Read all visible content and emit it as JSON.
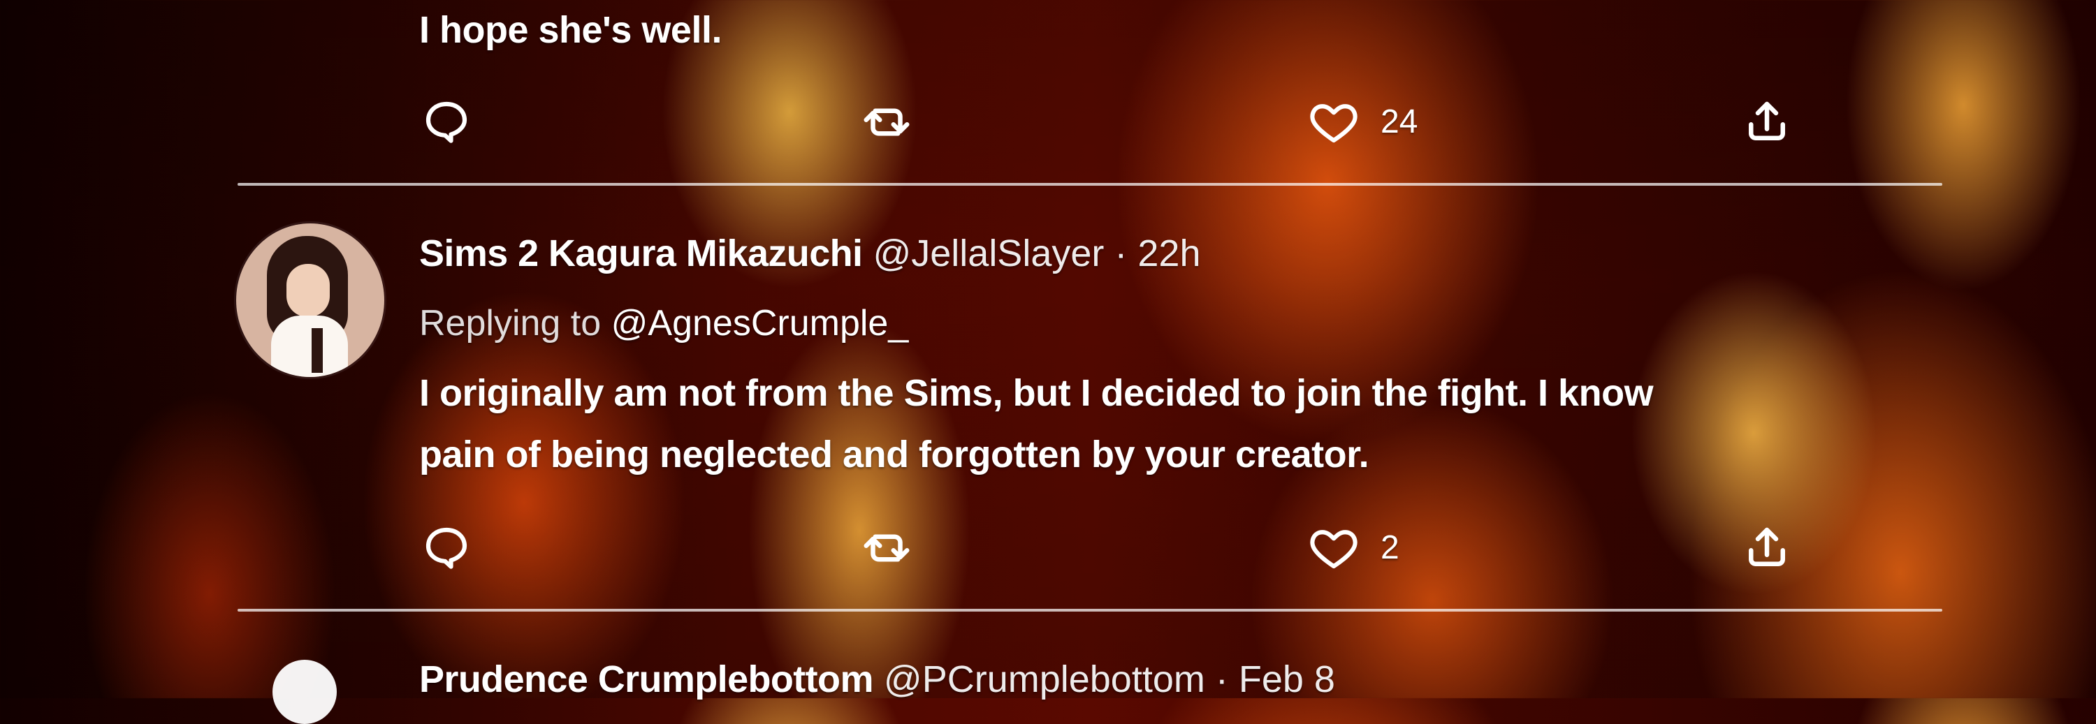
{
  "colors": {
    "background": "#3d0500",
    "text": "#ffffff",
    "divider": "#ffffff"
  },
  "tweets": [
    {
      "text": "I hope she's well.",
      "actions": {
        "reply_icon": "comment-bubble-icon",
        "retweet_icon": "retweet-icon",
        "like_icon": "heart-icon",
        "share_icon": "share-icon",
        "likes": "24"
      }
    },
    {
      "display_name": "Sims 2 Kagura Mikazuchi",
      "handle": "@JellalSlayer",
      "separator": "·",
      "time": "22h",
      "replying_label": "Replying to",
      "replying_handle": "@AgnesCrumple_",
      "text_lines": [
        "I originally am not from the Sims, but I decided to join the fight. I know",
        "pain of being neglected and forgotten by your creator."
      ],
      "actions": {
        "reply_icon": "comment-bubble-icon",
        "retweet_icon": "retweet-icon",
        "like_icon": "heart-icon",
        "share_icon": "share-icon",
        "likes": "2"
      }
    },
    {
      "display_name": "Prudence Crumplebottom",
      "handle": "@PCrumplebottom",
      "separator": "·",
      "time": "Feb 8"
    }
  ]
}
